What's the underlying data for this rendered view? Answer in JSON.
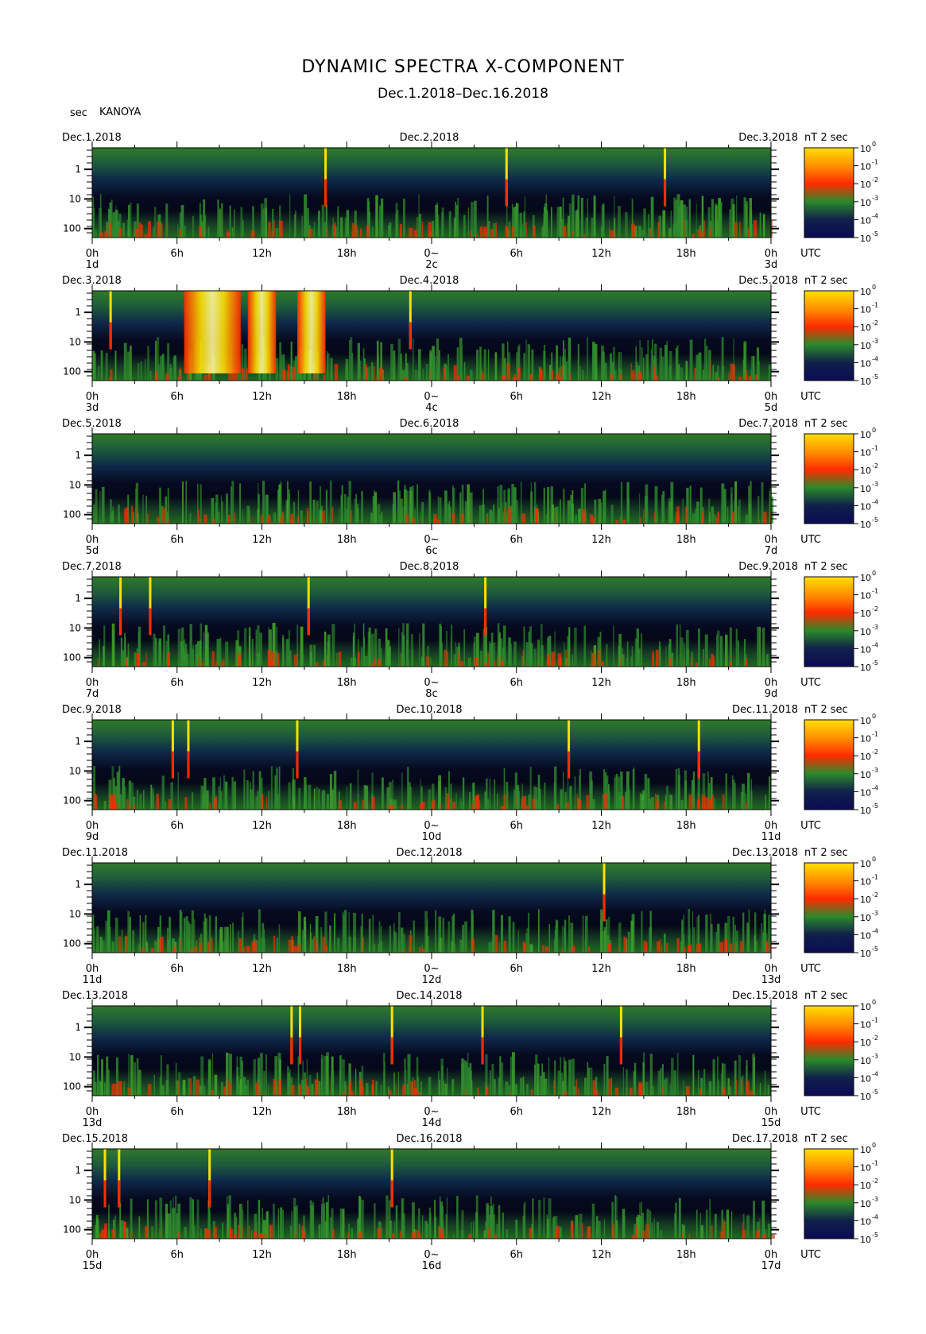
{
  "title": "DYNAMIC SPECTRA X-COMPONENT",
  "subtitle": "Dec.1.2018–Dec.16.2018",
  "yaxis_unit": "sec",
  "station": "KANOYA",
  "colorbar_unit_prefix": "nT",
  "colorbar_unit_exp": "2",
  "colorbar_unit_suffix": "sec",
  "utc_label": "UTC",
  "colors": {
    "low": "#0b0b55",
    "mid": "#1f7d1f",
    "high": "#ff2a00",
    "peak": "#ffe000",
    "frame": "#000000"
  },
  "chart_data": [
    {
      "type": "heatmap",
      "date_left": "Dec.1.2018",
      "date_mid": "Dec.2.2018",
      "date_right": "Dec.3.2018",
      "day_start": "1d",
      "day_mid": "2c",
      "day_end": "3d",
      "spike_hours": [
        16.5,
        29.3,
        40.5
      ],
      "burst_hours": []
    },
    {
      "type": "heatmap",
      "date_left": "Dec.3.2018",
      "date_mid": "Dec.4.2018",
      "date_right": "Dec.5.2018",
      "day_start": "3d",
      "day_mid": "4c",
      "day_end": "5d",
      "spike_hours": [
        1.3,
        22.5
      ],
      "burst_hours": [
        [
          6.5,
          10.5
        ],
        [
          11,
          13
        ],
        [
          14.5,
          16.5
        ]
      ]
    },
    {
      "type": "heatmap",
      "date_left": "Dec.5.2018",
      "date_mid": "Dec.6.2018",
      "date_right": "Dec.7.2018",
      "day_start": "5d",
      "day_mid": "6c",
      "day_end": "7d",
      "spike_hours": [],
      "burst_hours": []
    },
    {
      "type": "heatmap",
      "date_left": "Dec.7.2018",
      "date_mid": "Dec.8.2018",
      "date_right": "Dec.9.2018",
      "day_start": "7d",
      "day_mid": "8c",
      "day_end": "9d",
      "spike_hours": [
        2.0,
        4.1,
        15.3,
        27.8
      ],
      "burst_hours": []
    },
    {
      "type": "heatmap",
      "date_left": "Dec.9.2018",
      "date_mid": "Dec.10.2018",
      "date_right": "Dec.11.2018",
      "day_start": "9d",
      "day_mid": "10d",
      "day_end": "11d",
      "spike_hours": [
        5.7,
        6.8,
        14.5,
        33.7,
        42.9
      ],
      "burst_hours": []
    },
    {
      "type": "heatmap",
      "date_left": "Dec.11.2018",
      "date_mid": "Dec.12.2018",
      "date_right": "Dec.13.2018",
      "day_start": "11d",
      "day_mid": "12d",
      "day_end": "13d",
      "spike_hours": [
        36.2
      ],
      "burst_hours": []
    },
    {
      "type": "heatmap",
      "date_left": "Dec.13.2018",
      "date_mid": "Dec.14.2018",
      "date_right": "Dec.15.2018",
      "day_start": "13d",
      "day_mid": "14d",
      "day_end": "15d",
      "spike_hours": [
        14.1,
        14.7,
        21.2,
        27.6,
        37.4
      ],
      "burst_hours": []
    },
    {
      "type": "heatmap",
      "date_left": "Dec.15.2018",
      "date_mid": "Dec.16.2018",
      "date_right": "Dec.17.2018",
      "day_start": "15d",
      "day_mid": "16d",
      "day_end": "17d",
      "spike_hours": [
        0.9,
        1.9,
        8.3,
        21.2
      ],
      "burst_hours": []
    }
  ],
  "y_ticks": [
    "1",
    "10",
    "100"
  ],
  "x_ticks": [
    "0h",
    "6h",
    "12h",
    "18h",
    "0~",
    "6h",
    "12h",
    "18h",
    "0h"
  ],
  "colorbar_ticks": [
    "0",
    "-1",
    "-2",
    "-3",
    "-4",
    "-5"
  ]
}
